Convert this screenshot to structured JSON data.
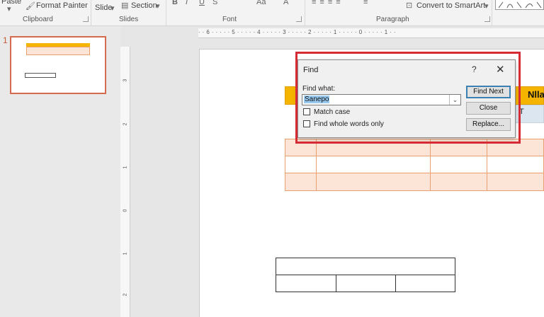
{
  "ribbon": {
    "paste_label": "Paste",
    "format_painter_label": "Format Painter",
    "new_slide_label": "Slide",
    "section_label": "Section",
    "convert_smartart_label": "Convert to SmartArt",
    "groups": {
      "clipboard": "Clipboard",
      "slides": "Slides",
      "font": "Font",
      "paragraph": "Paragraph"
    }
  },
  "thumbnails": {
    "slide_number": "1"
  },
  "ruler": {
    "horizontal": "· · 6 · · · · · 5 · · · · · 4 · · · · · 3 · · · · · 2 · · · · · 1 · · · · · 0 · · · · · 1 · ·",
    "vertical_ticks": [
      "3",
      "2",
      "1",
      "0",
      "1",
      "2"
    ]
  },
  "slide": {
    "header_partial_text": "Nlla",
    "partial_cell_text": "T"
  },
  "find_dialog": {
    "title": "Find",
    "help": "?",
    "close": "✕",
    "find_what_label": "Find what:",
    "find_what_value": "Sanepo",
    "match_case_label": "Match case",
    "match_case_checked": false,
    "whole_words_label": "Find whole words only",
    "whole_words_checked": false,
    "find_next_label": "Find Next",
    "close_label": "Close",
    "replace_label": "Replace...",
    "highlight_color": "#d62b35"
  }
}
